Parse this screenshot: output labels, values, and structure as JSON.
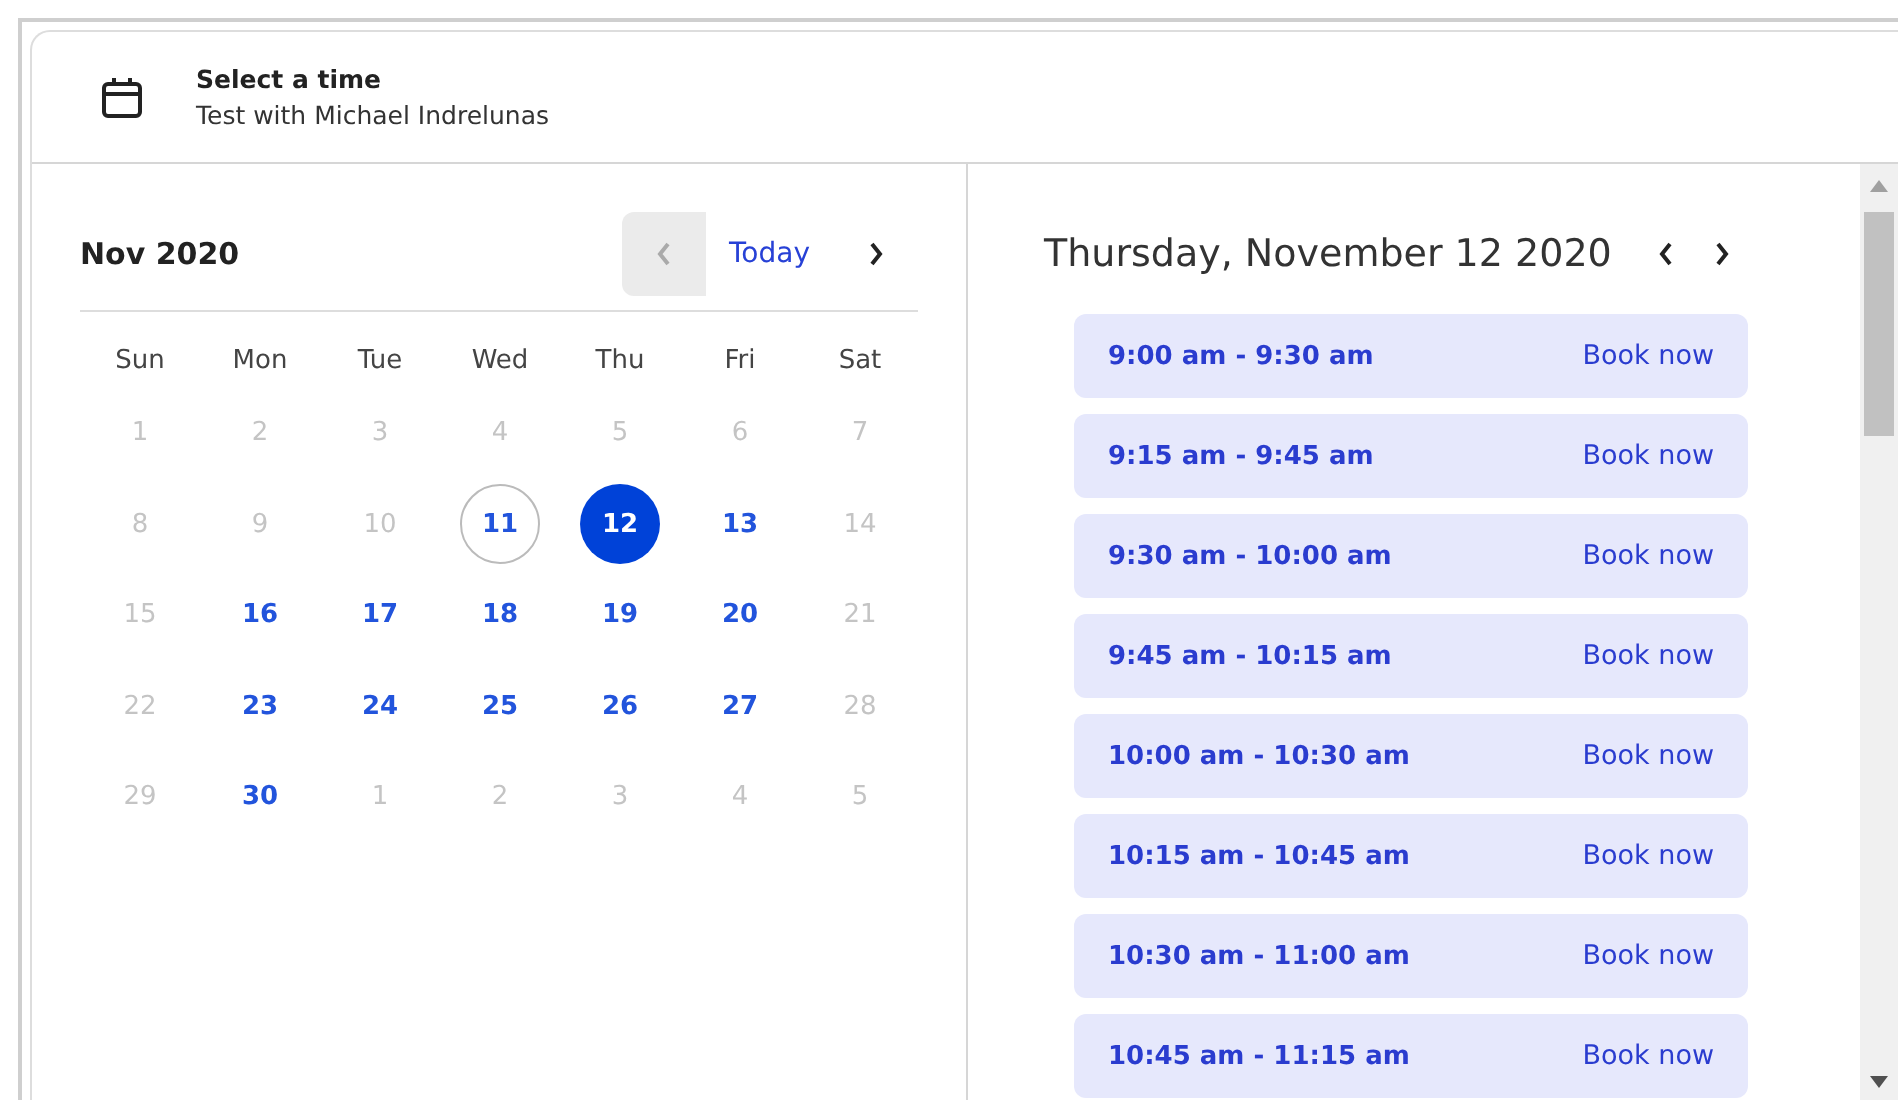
{
  "header": {
    "title": "Select a time",
    "subtitle": "Test with Michael Indrelunas"
  },
  "calendar": {
    "month": "Nov 2020",
    "today_button": "Today",
    "prev_disabled": true,
    "weekdays": [
      "Sun",
      "Mon",
      "Tue",
      "Wed",
      "Thu",
      "Fri",
      "Sat"
    ],
    "days": [
      {
        "text": "1",
        "kind": "muted",
        "selected": false
      },
      {
        "text": "2",
        "kind": "muted",
        "selected": false
      },
      {
        "text": "3",
        "kind": "muted",
        "selected": false
      },
      {
        "text": "4",
        "kind": "muted",
        "selected": false
      },
      {
        "text": "5",
        "kind": "muted",
        "selected": false
      },
      {
        "text": "6",
        "kind": "muted",
        "selected": false
      },
      {
        "text": "7",
        "kind": "muted",
        "selected": false
      },
      {
        "text": "8",
        "kind": "muted",
        "selected": false
      },
      {
        "text": "9",
        "kind": "muted",
        "selected": false
      },
      {
        "text": "10",
        "kind": "muted",
        "selected": false
      },
      {
        "text": "11",
        "kind": "today",
        "selected": false
      },
      {
        "text": "12",
        "kind": "available",
        "selected": true
      },
      {
        "text": "13",
        "kind": "available",
        "selected": false
      },
      {
        "text": "14",
        "kind": "muted",
        "selected": false
      },
      {
        "text": "15",
        "kind": "muted",
        "selected": false
      },
      {
        "text": "16",
        "kind": "available",
        "selected": false
      },
      {
        "text": "17",
        "kind": "available",
        "selected": false
      },
      {
        "text": "18",
        "kind": "available",
        "selected": false
      },
      {
        "text": "19",
        "kind": "available",
        "selected": false
      },
      {
        "text": "20",
        "kind": "available",
        "selected": false
      },
      {
        "text": "21",
        "kind": "muted",
        "selected": false
      },
      {
        "text": "22",
        "kind": "muted",
        "selected": false
      },
      {
        "text": "23",
        "kind": "available",
        "selected": false
      },
      {
        "text": "24",
        "kind": "available",
        "selected": false
      },
      {
        "text": "25",
        "kind": "available",
        "selected": false
      },
      {
        "text": "26",
        "kind": "available",
        "selected": false
      },
      {
        "text": "27",
        "kind": "available",
        "selected": false
      },
      {
        "text": "28",
        "kind": "muted",
        "selected": false
      },
      {
        "text": "29",
        "kind": "muted",
        "selected": false
      },
      {
        "text": "30",
        "kind": "available",
        "selected": false
      },
      {
        "text": "1",
        "kind": "muted",
        "selected": false
      },
      {
        "text": "2",
        "kind": "muted",
        "selected": false
      },
      {
        "text": "3",
        "kind": "muted",
        "selected": false
      },
      {
        "text": "4",
        "kind": "muted",
        "selected": false
      },
      {
        "text": "5",
        "kind": "muted",
        "selected": false
      }
    ]
  },
  "slots": {
    "date": "Thursday, November 12 2020",
    "items": [
      {
        "time": "9:00 am - 9:30 am",
        "action": "Book now"
      },
      {
        "time": "9:15 am - 9:45 am",
        "action": "Book now"
      },
      {
        "time": "9:30 am - 10:00 am",
        "action": "Book now"
      },
      {
        "time": "9:45 am - 10:15 am",
        "action": "Book now"
      },
      {
        "time": "10:00 am - 10:30 am",
        "action": "Book now"
      },
      {
        "time": "10:15 am - 10:45 am",
        "action": "Book now"
      },
      {
        "time": "10:30 am - 11:00 am",
        "action": "Book now"
      },
      {
        "time": "10:45 am - 11:15 am",
        "action": "Book now"
      }
    ]
  }
}
